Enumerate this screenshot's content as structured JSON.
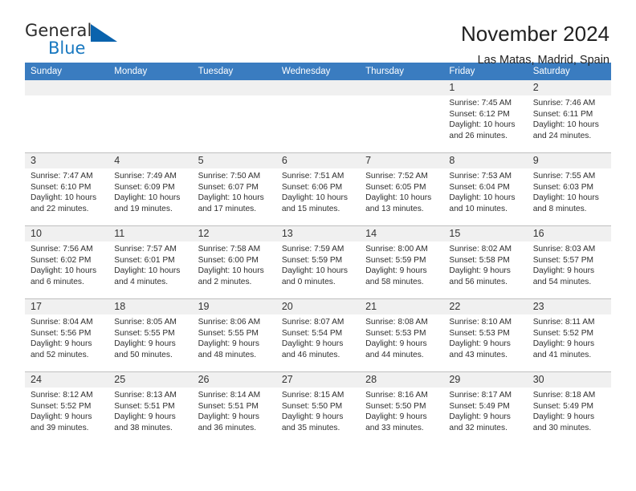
{
  "brand": {
    "word1": "General",
    "word2": "Blue",
    "logo_icon": "blue-triangle-icon",
    "accent_color": "#1878c0"
  },
  "header": {
    "title": "November 2024",
    "subtitle": "Las Matas, Madrid, Spain"
  },
  "calendar": {
    "header_bg": "#3a7cc0",
    "daynum_bg": "#f0f0f0",
    "weekdays": [
      "Sunday",
      "Monday",
      "Tuesday",
      "Wednesday",
      "Thursday",
      "Friday",
      "Saturday"
    ],
    "weeks": [
      [
        {
          "day": "",
          "lines": []
        },
        {
          "day": "",
          "lines": []
        },
        {
          "day": "",
          "lines": []
        },
        {
          "day": "",
          "lines": []
        },
        {
          "day": "",
          "lines": []
        },
        {
          "day": "1",
          "lines": [
            "Sunrise: 7:45 AM",
            "Sunset: 6:12 PM",
            "Daylight: 10 hours and 26 minutes."
          ]
        },
        {
          "day": "2",
          "lines": [
            "Sunrise: 7:46 AM",
            "Sunset: 6:11 PM",
            "Daylight: 10 hours and 24 minutes."
          ]
        }
      ],
      [
        {
          "day": "3",
          "lines": [
            "Sunrise: 7:47 AM",
            "Sunset: 6:10 PM",
            "Daylight: 10 hours and 22 minutes."
          ]
        },
        {
          "day": "4",
          "lines": [
            "Sunrise: 7:49 AM",
            "Sunset: 6:09 PM",
            "Daylight: 10 hours and 19 minutes."
          ]
        },
        {
          "day": "5",
          "lines": [
            "Sunrise: 7:50 AM",
            "Sunset: 6:07 PM",
            "Daylight: 10 hours and 17 minutes."
          ]
        },
        {
          "day": "6",
          "lines": [
            "Sunrise: 7:51 AM",
            "Sunset: 6:06 PM",
            "Daylight: 10 hours and 15 minutes."
          ]
        },
        {
          "day": "7",
          "lines": [
            "Sunrise: 7:52 AM",
            "Sunset: 6:05 PM",
            "Daylight: 10 hours and 13 minutes."
          ]
        },
        {
          "day": "8",
          "lines": [
            "Sunrise: 7:53 AM",
            "Sunset: 6:04 PM",
            "Daylight: 10 hours and 10 minutes."
          ]
        },
        {
          "day": "9",
          "lines": [
            "Sunrise: 7:55 AM",
            "Sunset: 6:03 PM",
            "Daylight: 10 hours and 8 minutes."
          ]
        }
      ],
      [
        {
          "day": "10",
          "lines": [
            "Sunrise: 7:56 AM",
            "Sunset: 6:02 PM",
            "Daylight: 10 hours and 6 minutes."
          ]
        },
        {
          "day": "11",
          "lines": [
            "Sunrise: 7:57 AM",
            "Sunset: 6:01 PM",
            "Daylight: 10 hours and 4 minutes."
          ]
        },
        {
          "day": "12",
          "lines": [
            "Sunrise: 7:58 AM",
            "Sunset: 6:00 PM",
            "Daylight: 10 hours and 2 minutes."
          ]
        },
        {
          "day": "13",
          "lines": [
            "Sunrise: 7:59 AM",
            "Sunset: 5:59 PM",
            "Daylight: 10 hours and 0 minutes."
          ]
        },
        {
          "day": "14",
          "lines": [
            "Sunrise: 8:00 AM",
            "Sunset: 5:59 PM",
            "Daylight: 9 hours and 58 minutes."
          ]
        },
        {
          "day": "15",
          "lines": [
            "Sunrise: 8:02 AM",
            "Sunset: 5:58 PM",
            "Daylight: 9 hours and 56 minutes."
          ]
        },
        {
          "day": "16",
          "lines": [
            "Sunrise: 8:03 AM",
            "Sunset: 5:57 PM",
            "Daylight: 9 hours and 54 minutes."
          ]
        }
      ],
      [
        {
          "day": "17",
          "lines": [
            "Sunrise: 8:04 AM",
            "Sunset: 5:56 PM",
            "Daylight: 9 hours and 52 minutes."
          ]
        },
        {
          "day": "18",
          "lines": [
            "Sunrise: 8:05 AM",
            "Sunset: 5:55 PM",
            "Daylight: 9 hours and 50 minutes."
          ]
        },
        {
          "day": "19",
          "lines": [
            "Sunrise: 8:06 AM",
            "Sunset: 5:55 PM",
            "Daylight: 9 hours and 48 minutes."
          ]
        },
        {
          "day": "20",
          "lines": [
            "Sunrise: 8:07 AM",
            "Sunset: 5:54 PM",
            "Daylight: 9 hours and 46 minutes."
          ]
        },
        {
          "day": "21",
          "lines": [
            "Sunrise: 8:08 AM",
            "Sunset: 5:53 PM",
            "Daylight: 9 hours and 44 minutes."
          ]
        },
        {
          "day": "22",
          "lines": [
            "Sunrise: 8:10 AM",
            "Sunset: 5:53 PM",
            "Daylight: 9 hours and 43 minutes."
          ]
        },
        {
          "day": "23",
          "lines": [
            "Sunrise: 8:11 AM",
            "Sunset: 5:52 PM",
            "Daylight: 9 hours and 41 minutes."
          ]
        }
      ],
      [
        {
          "day": "24",
          "lines": [
            "Sunrise: 8:12 AM",
            "Sunset: 5:52 PM",
            "Daylight: 9 hours and 39 minutes."
          ]
        },
        {
          "day": "25",
          "lines": [
            "Sunrise: 8:13 AM",
            "Sunset: 5:51 PM",
            "Daylight: 9 hours and 38 minutes."
          ]
        },
        {
          "day": "26",
          "lines": [
            "Sunrise: 8:14 AM",
            "Sunset: 5:51 PM",
            "Daylight: 9 hours and 36 minutes."
          ]
        },
        {
          "day": "27",
          "lines": [
            "Sunrise: 8:15 AM",
            "Sunset: 5:50 PM",
            "Daylight: 9 hours and 35 minutes."
          ]
        },
        {
          "day": "28",
          "lines": [
            "Sunrise: 8:16 AM",
            "Sunset: 5:50 PM",
            "Daylight: 9 hours and 33 minutes."
          ]
        },
        {
          "day": "29",
          "lines": [
            "Sunrise: 8:17 AM",
            "Sunset: 5:49 PM",
            "Daylight: 9 hours and 32 minutes."
          ]
        },
        {
          "day": "30",
          "lines": [
            "Sunrise: 8:18 AM",
            "Sunset: 5:49 PM",
            "Daylight: 9 hours and 30 minutes."
          ]
        }
      ]
    ]
  }
}
